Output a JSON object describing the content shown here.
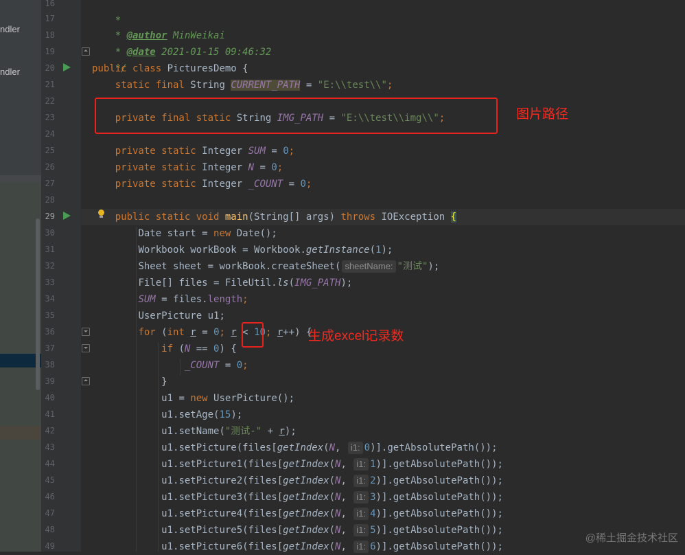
{
  "left_panel": {
    "items": [
      {
        "text": "ndler"
      },
      {
        "text": "ndler"
      }
    ]
  },
  "gutter": {
    "line_numbers": [
      "16",
      "17",
      "18",
      "19",
      "20",
      "21",
      "22",
      "23",
      "24",
      "25",
      "26",
      "27",
      "28",
      "29",
      "30",
      "31",
      "32",
      "33",
      "34",
      "35",
      "36",
      "37",
      "38",
      "39",
      "40",
      "41",
      "42",
      "43",
      "44",
      "45",
      "46",
      "47",
      "48",
      "49"
    ]
  },
  "code": {
    "l16": "*",
    "l17_tag": "@author",
    "l17_rest": " MinWeikai",
    "l18_tag": "@date",
    "l18_rest": " 2021-01-15 09:46:32",
    "l19": "*/",
    "l20_kw": "public class",
    "l20_rest": " PicturesDemo {",
    "l21_kw": "static final",
    "l21_type": " String ",
    "l21_field": "CURRENT_PATH",
    "l21_eq": " = ",
    "l21_str": "\"E:\\\\test\\\\\"",
    "l21_semi": ";",
    "l23_kw": "private final static",
    "l23_type": " String ",
    "l23_field": "IMG_PATH",
    "l23_eq": " = ",
    "l23_str": "\"E:\\\\test\\\\img\\\\\"",
    "l23_semi": ";",
    "l25_kw": "private static",
    "l25_type": " Integer ",
    "l25_field": "SUM",
    "l25_eq": " = ",
    "l25_num": "0",
    "l25_semi": ";",
    "l26_kw": "private static",
    "l26_type": " Integer ",
    "l26_field": "N",
    "l26_eq": " = ",
    "l26_num": "0",
    "l26_semi": ";",
    "l27_kw": "private static",
    "l27_type": " Integer ",
    "l27_field": "_COUNT",
    "l27_eq": " = ",
    "l27_num": "0",
    "l27_semi": ";",
    "l29_kw": "public static void",
    "l29_fn": "main",
    "l29_mid": "(String[] args) ",
    "l29_kw2": "throws",
    "l29_exc": " IOException ",
    "l29_brace": "{",
    "l30_a": "Date start = ",
    "l30_kw": "new",
    "l30_b": " Date();",
    "l31_a": "Workbook workBook = Workbook.",
    "l31_m": "getInstance",
    "l31_b": "(",
    "l31_num": "1",
    "l31_c": ");",
    "l32_a": "Sheet sheet = workBook.createSheet(",
    "l32_hint": "sheetName:",
    "l32_str": "\"测试\"",
    "l32_b": ");",
    "l33_a": "File[] files = FileUtil.",
    "l33_m": "ls",
    "l33_b": "(",
    "l33_field": "IMG_PATH",
    "l33_c": ");",
    "l34_field": "SUM",
    "l34_a": " = files.",
    "l34_len": "length",
    "l34_b": ";",
    "l35": "UserPicture u1;",
    "l36_kw": "for",
    "l36_a": " (",
    "l36_kw2": "int",
    "l36_b": " ",
    "l36_r1": "r",
    "l36_c": " = ",
    "l36_n0": "0",
    "l36_d": "; ",
    "l36_r2": "r",
    "l36_e": " < ",
    "l36_n10": "10",
    "l36_f": "; ",
    "l36_r3": "r",
    "l36_g": "++) {",
    "l37_kw": "if",
    "l37_a": " (",
    "l37_field": "N",
    "l37_b": " == ",
    "l37_num": "0",
    "l37_c": ") {",
    "l38_field": "_COUNT",
    "l38_a": " = ",
    "l38_num": "0",
    "l38_b": ";",
    "l39": "}",
    "l40_a": "u1 = ",
    "l40_kw": "new",
    "l40_b": " UserPicture();",
    "l41_a": "u1.setAge(",
    "l41_num": "15",
    "l41_b": ");",
    "l42_a": "u1.setName(",
    "l42_str": "\"测试-\"",
    "l42_b": " + ",
    "l42_r": "r",
    "l42_c": ");",
    "pic_lines": [
      {
        "pre": "u1.setPicture(files[",
        "m": "getIndex",
        "arg": "(",
        "f": "N",
        "comma": ", ",
        "hint": "i1:",
        "num": "0",
        "post": ")].getAbsolutePath());"
      },
      {
        "pre": "u1.setPicture1(files[",
        "m": "getIndex",
        "arg": "(",
        "f": "N",
        "comma": ", ",
        "hint": "i1:",
        "num": "1",
        "post": ")].getAbsolutePath());"
      },
      {
        "pre": "u1.setPicture2(files[",
        "m": "getIndex",
        "arg": "(",
        "f": "N",
        "comma": ", ",
        "hint": "i1:",
        "num": "2",
        "post": ")].getAbsolutePath());"
      },
      {
        "pre": "u1.setPicture3(files[",
        "m": "getIndex",
        "arg": "(",
        "f": "N",
        "comma": ", ",
        "hint": "i1:",
        "num": "3",
        "post": ")].getAbsolutePath());"
      },
      {
        "pre": "u1.setPicture4(files[",
        "m": "getIndex",
        "arg": "(",
        "f": "N",
        "comma": ", ",
        "hint": "i1:",
        "num": "4",
        "post": ")].getAbsolutePath());"
      },
      {
        "pre": "u1.setPicture5(files[",
        "m": "getIndex",
        "arg": "(",
        "f": "N",
        "comma": ", ",
        "hint": "i1:",
        "num": "5",
        "post": ")].getAbsolutePath());"
      },
      {
        "pre": "u1.setPicture6(files[",
        "m": "getIndex",
        "arg": "(",
        "f": "N",
        "comma": ", ",
        "hint": "i1:",
        "num": "6",
        "post": ")].getAbsolutePath());"
      }
    ]
  },
  "annotations": {
    "img_path_note": "图片路径",
    "count_note": "生成excel记录数"
  },
  "watermark": "@稀土掘金技术社区",
  "colors": {
    "editor_bg": "#2b2b2b",
    "gutter_bg": "#313335",
    "keyword": "#cc7832",
    "string": "#6a8759",
    "number": "#6897bb",
    "static_field": "#9876aa",
    "function": "#ffc66d",
    "annotation_red": "#e8231c"
  }
}
